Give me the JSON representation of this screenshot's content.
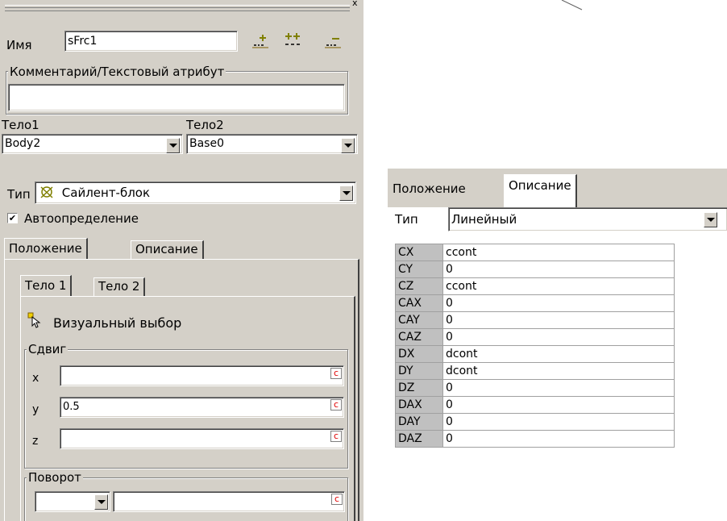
{
  "left_panel": {
    "close_glyph": "x",
    "name_label": "Имя",
    "name_value": "sFrc1",
    "comment_title": "Комментарий/Текстовый атрибут",
    "comment_value": "",
    "body1_label": "Тело1",
    "body1_value": "Body2",
    "body2_label": "Тело2",
    "body2_value": "Base0",
    "type_label": "Тип",
    "type_value": "Сайлент-блок",
    "auto_label": "Автоопределение",
    "auto_checked": "✔",
    "tabs": [
      "Положение",
      "Описание"
    ],
    "subtabs": [
      "Тело 1",
      "Тело 2"
    ],
    "visual_select": "Визуальный выбор",
    "shift_title": "Сдвиг",
    "shift": [
      {
        "axis": "x",
        "value": ""
      },
      {
        "axis": "y",
        "value": "0.5"
      },
      {
        "axis": "z",
        "value": ""
      }
    ],
    "c_glyph": "c",
    "rotation_title": "Поворот",
    "rotation_value": ""
  },
  "right_panel": {
    "tabs": [
      "Положение",
      "Описание"
    ],
    "type_label": "Тип",
    "type_value": "Линейный",
    "params": [
      {
        "name": "CX",
        "value": "ccont"
      },
      {
        "name": "CY",
        "value": "0"
      },
      {
        "name": "CZ",
        "value": "ccont"
      },
      {
        "name": "CAX",
        "value": "0"
      },
      {
        "name": "CAY",
        "value": "0"
      },
      {
        "name": "CAZ",
        "value": "0"
      },
      {
        "name": "DX",
        "value": "dcont"
      },
      {
        "name": "DY",
        "value": "dcont"
      },
      {
        "name": "DZ",
        "value": "0"
      },
      {
        "name": "DAX",
        "value": "0"
      },
      {
        "name": "DAY",
        "value": "0"
      },
      {
        "name": "DAZ",
        "value": "0"
      }
    ]
  }
}
